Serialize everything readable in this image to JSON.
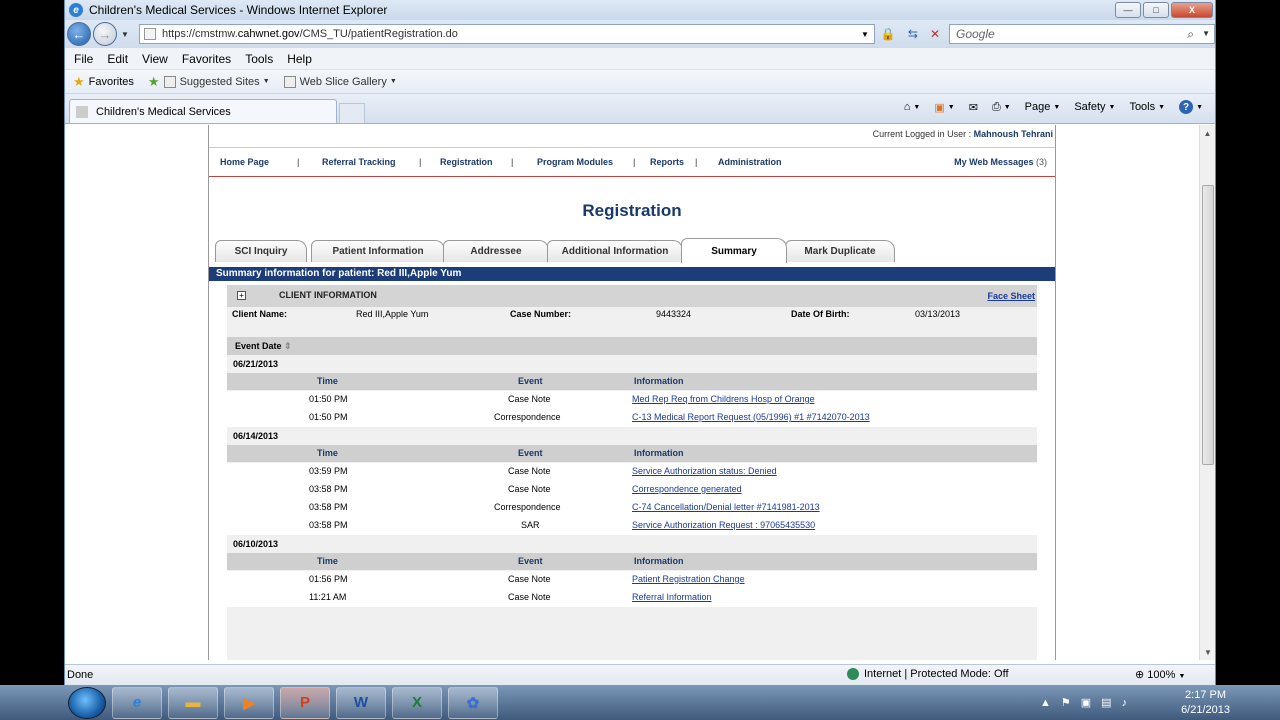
{
  "window": {
    "title": "Children's Medical Services - Windows Internet Explorer",
    "address": "https://cmstmw.cahwnet.gov/CMS_TU/patientRegistration.do",
    "address_prefix": "https://cmstmw.",
    "address_domain": "cahwnet.gov",
    "address_path": "/CMS_TU/patientRegistration.do",
    "search_placeholder": "Google",
    "window_buttons": {
      "min": "—",
      "max": "□",
      "close": "X"
    }
  },
  "menu": [
    "File",
    "Edit",
    "View",
    "Favorites",
    "Tools",
    "Help"
  ],
  "favorites_bar": {
    "favorites_label": "Favorites",
    "suggested_sites": "Suggested Sites",
    "web_slice_gallery": "Web Slice Gallery"
  },
  "browser_tab": {
    "label": "Children's Medical Services"
  },
  "command_bar": {
    "page": "Page",
    "safety": "Safety",
    "tools": "Tools"
  },
  "app": {
    "logged_in_label": "Current Logged in User :",
    "logged_in_user": "Mahnoush Tehrani",
    "nav": {
      "home": "Home Page",
      "referral": "Referral Tracking",
      "registration": "Registration",
      "program_modules": "Program Modules",
      "reports": "Reports",
      "administration": "Administration",
      "web_messages": "My Web Messages",
      "web_messages_count": "(3)"
    },
    "page_title": "Registration",
    "tabs": {
      "sci_inquiry": "SCI Inquiry",
      "patient_information": "Patient Information",
      "addressee": "Addressee",
      "additional_information": "Additional Information",
      "summary": "Summary",
      "mark_duplicate": "Mark Duplicate"
    },
    "summary_bar": "Summary information for patient: Red III,Apple Yum",
    "client": {
      "section_label": "CLIENT INFORMATION",
      "face_sheet": "Face Sheet",
      "name_label": "Client Name:",
      "name_value": "Red III,Apple Yum",
      "case_label": "Case Number:",
      "case_value": "9443324",
      "dob_label": "Date Of Birth:",
      "dob_value": "03/13/2013"
    },
    "event_date_header": "Event Date",
    "columns": {
      "time": "Time",
      "event": "Event",
      "information": "Information"
    },
    "groups": [
      {
        "date": "06/21/2013",
        "rows": [
          {
            "time": "01:50 PM",
            "event": "Case Note",
            "info": "Med Rep Req from Childrens Hosp of Orange"
          },
          {
            "time": "01:50 PM",
            "event": "Correspondence",
            "info": "C-13 Medical Report Request (05/1996) #1 #7142070-2013"
          }
        ]
      },
      {
        "date": "06/14/2013",
        "rows": [
          {
            "time": "03:59 PM",
            "event": "Case Note",
            "info": "Service Authorization status: Denied"
          },
          {
            "time": "03:58 PM",
            "event": "Case Note",
            "info": "Correspondence generated"
          },
          {
            "time": "03:58 PM",
            "event": "Correspondence",
            "info": "C-74 Cancellation/Denial letter #7141981-2013"
          },
          {
            "time": "03:58 PM",
            "event": "SAR",
            "info": "Service Authorization Request : 97065435530"
          }
        ]
      },
      {
        "date": "06/10/2013",
        "rows": [
          {
            "time": "01:56 PM",
            "event": "Case Note",
            "info": "Patient Registration Change"
          },
          {
            "time": "11:21 AM",
            "event": "Case Note",
            "info": "Referral Information"
          }
        ]
      }
    ]
  },
  "status_bar": {
    "left": "Done",
    "zone": "Internet | Protected Mode: Off",
    "zoom": "100%"
  },
  "taskbar": {
    "clock_time": "2:17 PM",
    "clock_date": "6/21/2013"
  }
}
